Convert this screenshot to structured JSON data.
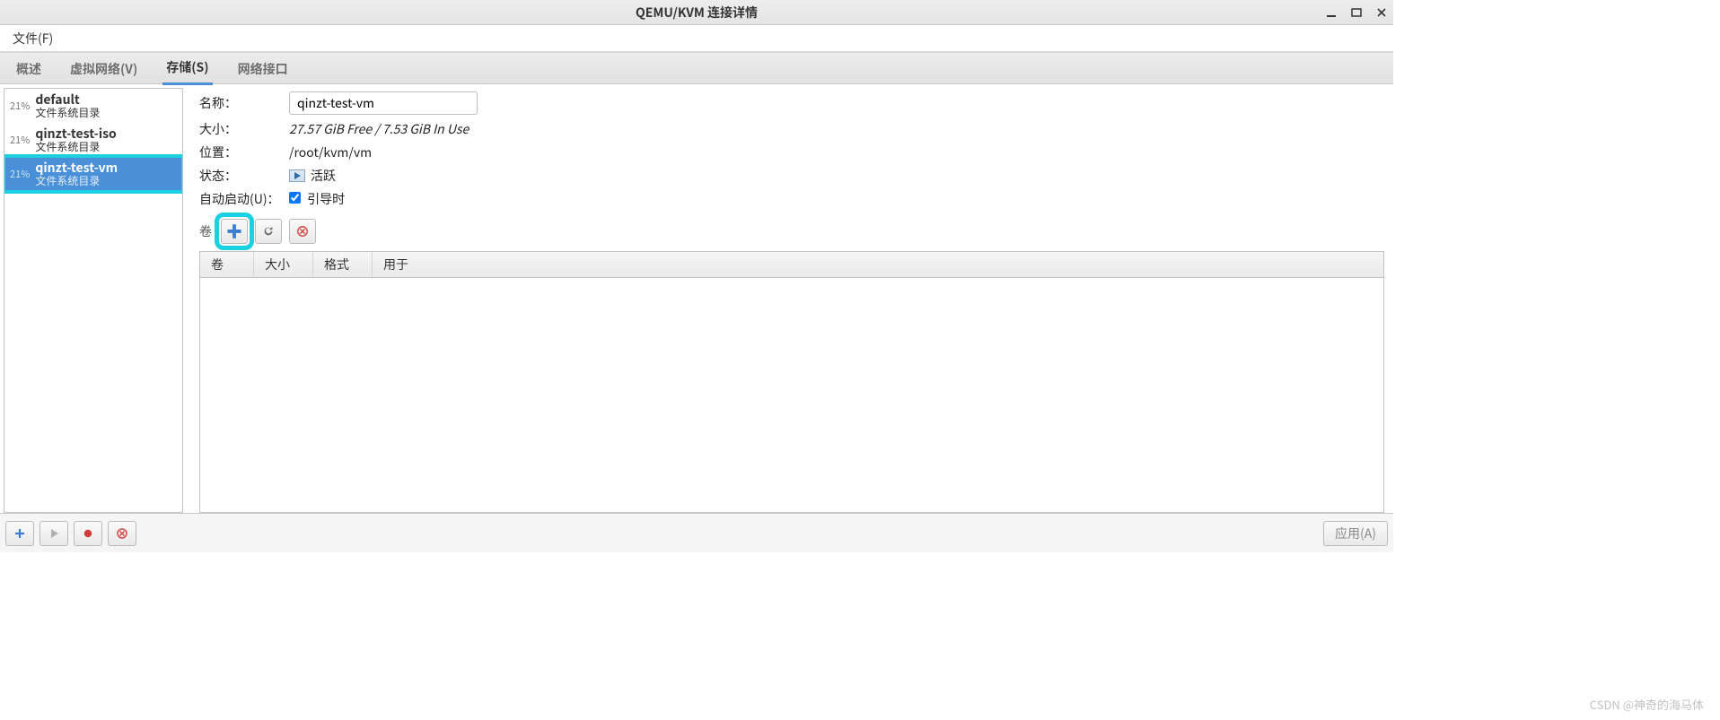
{
  "window": {
    "title": "QEMU/KVM 连接详情"
  },
  "menu": {
    "file": "文件(F)"
  },
  "tabs": [
    {
      "label": "概述"
    },
    {
      "label": "虚拟网络(V)"
    },
    {
      "label": "存储(S)"
    },
    {
      "label": "网络接口"
    }
  ],
  "pools": [
    {
      "pct": "21%",
      "name": "default",
      "sub": "文件系统目录"
    },
    {
      "pct": "21%",
      "name": "qinzt-test-iso",
      "sub": "文件系统目录"
    },
    {
      "pct": "21%",
      "name": "qinzt-test-vm",
      "sub": "文件系统目录"
    }
  ],
  "details": {
    "name_label": "名称：",
    "name_value": "qinzt-test-vm",
    "size_label": "大小：",
    "size_value": "27.57 GiB Free / 7.53 GiB In Use",
    "location_label": "位置：",
    "location_value": "/root/kvm/vm",
    "status_label": "状态：",
    "status_value": "活跃",
    "autostart_label": "自动启动(U)：",
    "autostart_value": "引导时",
    "vol_group_label": "卷"
  },
  "vol_headers": {
    "c1": "卷",
    "c2": "大小",
    "c3": "格式",
    "c4": "用于"
  },
  "footer": {
    "apply": "应用(A)"
  },
  "watermark": "CSDN @神奇的海马体"
}
